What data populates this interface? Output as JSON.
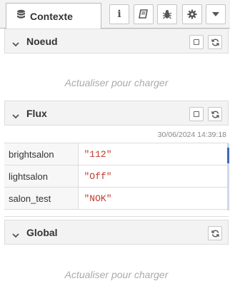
{
  "tab": {
    "label": "Contexte",
    "icon": "database-icon"
  },
  "toolbar": {
    "buttons": [
      {
        "name": "info-icon",
        "glyph": "i"
      },
      {
        "name": "book-icon"
      },
      {
        "name": "bug-icon"
      },
      {
        "name": "gear-icon"
      },
      {
        "name": "caret-down-icon"
      }
    ]
  },
  "sections": {
    "node": {
      "title": "Noeud",
      "placeholder": "Actualiser pour charger"
    },
    "flow": {
      "title": "Flux",
      "timestamp": "30/06/2024 14:39:18",
      "rows": [
        {
          "key": "brightsalon",
          "value": "\"112\""
        },
        {
          "key": "lightsalon",
          "value": "\"Off\""
        },
        {
          "key": "salon_test",
          "value": "\"NOK\""
        }
      ]
    },
    "global": {
      "title": "Global",
      "placeholder": "Actualiser pour charger"
    }
  },
  "colors": {
    "value_text": "#c0392b",
    "header_bg": "#f3f3f3",
    "placeholder_text": "#aaaaaa"
  }
}
